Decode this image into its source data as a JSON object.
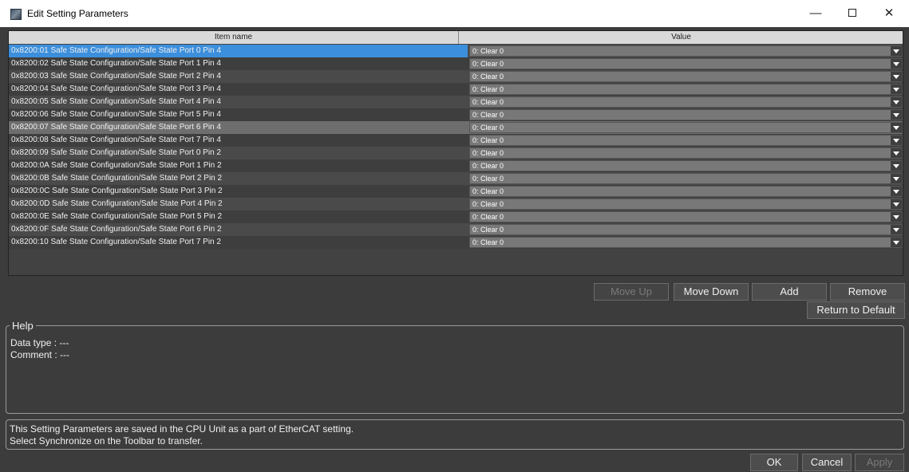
{
  "window": {
    "title": "Edit Setting Parameters",
    "minimize_glyph": "—",
    "close_glyph": "✕"
  },
  "grid": {
    "columns": [
      "Item name",
      "Value"
    ],
    "rows": [
      {
        "name": "0x8200:01 Safe State Configuration/Safe State Port 0 Pin 4",
        "value": "0: Clear 0"
      },
      {
        "name": "0x8200:02 Safe State Configuration/Safe State Port 1 Pin 4",
        "value": "0: Clear 0"
      },
      {
        "name": "0x8200:03 Safe State Configuration/Safe State Port 2 Pin 4",
        "value": "0: Clear 0"
      },
      {
        "name": "0x8200:04 Safe State Configuration/Safe State Port 3 Pin 4",
        "value": "0: Clear 0"
      },
      {
        "name": "0x8200:05 Safe State Configuration/Safe State Port 4 Pin 4",
        "value": "0: Clear 0"
      },
      {
        "name": "0x8200:06 Safe State Configuration/Safe State Port 5 Pin 4",
        "value": "0: Clear 0"
      },
      {
        "name": "0x8200:07 Safe State Configuration/Safe State Port 6 Pin 4",
        "value": "0: Clear 0"
      },
      {
        "name": "0x8200:08 Safe State Configuration/Safe State Port 7 Pin 4",
        "value": "0: Clear 0"
      },
      {
        "name": "0x8200:09 Safe State Configuration/Safe State Port 0 Pin 2",
        "value": "0: Clear 0"
      },
      {
        "name": "0x8200:0A Safe State Configuration/Safe State Port 1 Pin 2",
        "value": "0: Clear 0"
      },
      {
        "name": "0x8200:0B Safe State Configuration/Safe State Port 2 Pin 2",
        "value": "0: Clear 0"
      },
      {
        "name": "0x8200:0C Safe State Configuration/Safe State Port 3 Pin 2",
        "value": "0: Clear 0"
      },
      {
        "name": "0x8200:0D Safe State Configuration/Safe State Port 4 Pin 2",
        "value": "0: Clear 0"
      },
      {
        "name": "0x8200:0E Safe State Configuration/Safe State Port 5 Pin 2",
        "value": "0: Clear 0"
      },
      {
        "name": "0x8200:0F Safe State Configuration/Safe State Port 6 Pin 2",
        "value": "0: Clear 0"
      },
      {
        "name": "0x8200:10 Safe State Configuration/Safe State Port 7 Pin 2",
        "value": "0: Clear 0"
      }
    ],
    "selected_row": 0,
    "hover_row": 6
  },
  "buttons": {
    "move_up": "Move Up",
    "move_down": "Move Down",
    "add": "Add",
    "remove": "Remove",
    "return_default": "Return to Default",
    "ok": "OK",
    "cancel": "Cancel",
    "apply": "Apply"
  },
  "help": {
    "legend": "Help",
    "data_type": "Data type : ---",
    "comment": "Comment : ---"
  },
  "note": {
    "line1": "This Setting Parameters are saved in the CPU Unit as a part of EtherCAT setting.",
    "line2": "Select Synchronize on the Toolbar to transfer."
  },
  "colors": {
    "background": "#3c3c3c",
    "row_even": "#4a4a4a",
    "row_odd": "#3e3e3e",
    "row_selected": "#3c8fdc",
    "row_hover": "#6e6e6e",
    "value_field": "#787878"
  }
}
